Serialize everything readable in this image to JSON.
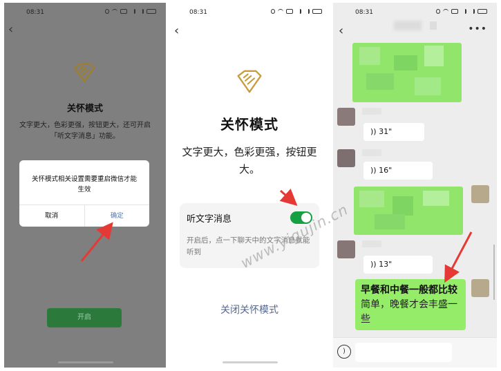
{
  "status": {
    "time": "08:31"
  },
  "panel1": {
    "title": "关怀模式",
    "desc": "文字更大，色彩更强，按钮更大，还可开启「听文字消息」功能。",
    "dialog_message": "关怀模式相关设置需要重启微信才能生效",
    "cancel_label": "取消",
    "confirm_label": "确定",
    "open_label": "开启"
  },
  "panel2": {
    "title": "关怀模式",
    "desc": "文字更大，色彩更强，按钮更大。",
    "option_label": "听文字消息",
    "option_desc": "开启后，点一下聊天中的文字消息就能听到",
    "close_label": "关闭关怀模式"
  },
  "panel3": {
    "voice_messages": [
      "31\"",
      "16\"",
      "13\""
    ],
    "text_bubble_bold": "早餐和中餐一般都比较",
    "text_bubble_rest": "简单，晚餐才会丰盛一些"
  },
  "watermark": "www.yigujin.cn",
  "colors": {
    "wechat_green": "#07c160",
    "toggle_green": "#169f43",
    "bubble_green": "#95ec69",
    "arrow_red": "#e53935",
    "logo_gold": "#c89b3c"
  },
  "icons": {
    "back": "chevron-left-icon",
    "logo": "heart-hand-icon",
    "voice": "sound-wave-icon",
    "more": "more-dots-icon"
  }
}
